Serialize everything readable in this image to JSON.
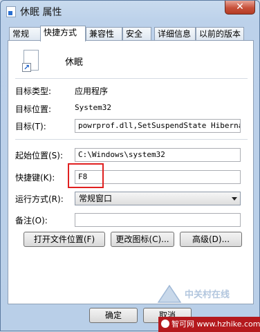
{
  "window": {
    "title": "休眠 属性",
    "close_glyph": "✕"
  },
  "tabs": [
    "常规",
    "快捷方式",
    "兼容性",
    "安全",
    "详细信息",
    "以前的版本"
  ],
  "active_tab": "快捷方式",
  "shortcut": {
    "name": "休眠",
    "target_type_label": "目标类型:",
    "target_type": "应用程序",
    "target_location_label": "目标位置:",
    "target_location": "System32",
    "target_label": "目标(T):",
    "target": "powrprof.dll,SetSuspendState Hibernate",
    "start_in_label": "起始位置(S):",
    "start_in": "C:\\Windows\\system32",
    "hotkey_label": "快捷键(K):",
    "hotkey": "F8",
    "run_label": "运行方式(R):",
    "run": "常规窗口",
    "comment_label": "备注(O):",
    "comment": ""
  },
  "buttons": {
    "open_location": "打开文件位置(F)",
    "change_icon": "更改图标(C)...",
    "advanced": "高级(D)...",
    "ok": "确定",
    "cancel": "取消"
  },
  "watermark": {
    "text": "中关村在线"
  },
  "banner": {
    "text": "智可网 www.hzhike.com"
  }
}
